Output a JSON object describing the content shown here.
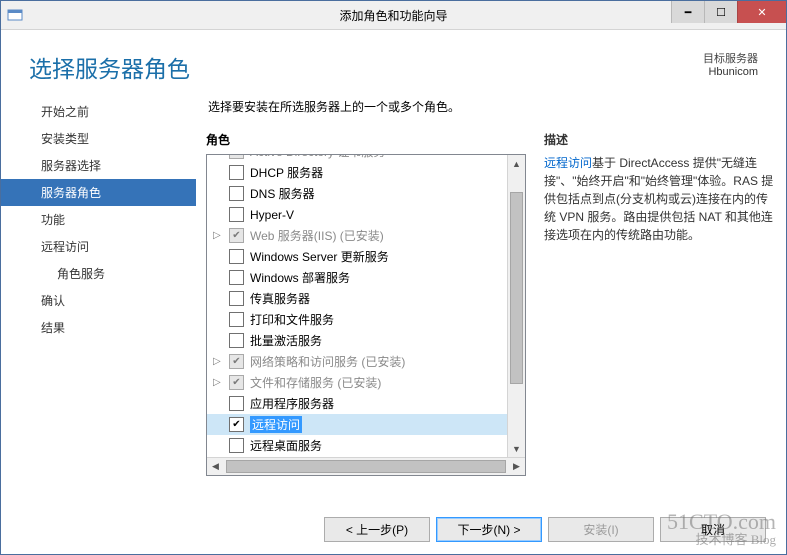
{
  "window": {
    "title": "添加角色和功能向导"
  },
  "header": {
    "page_title": "选择服务器角色",
    "target_label": "目标服务器",
    "target_value": "Hbunicom"
  },
  "nav": {
    "items": [
      {
        "label": "开始之前",
        "selected": false,
        "sub": false
      },
      {
        "label": "安装类型",
        "selected": false,
        "sub": false
      },
      {
        "label": "服务器选择",
        "selected": false,
        "sub": false
      },
      {
        "label": "服务器角色",
        "selected": true,
        "sub": false
      },
      {
        "label": "功能",
        "selected": false,
        "sub": false
      },
      {
        "label": "远程访问",
        "selected": false,
        "sub": false
      },
      {
        "label": "角色服务",
        "selected": false,
        "sub": true
      },
      {
        "label": "确认",
        "selected": false,
        "sub": false
      },
      {
        "label": "结果",
        "selected": false,
        "sub": false
      }
    ]
  },
  "content": {
    "instruction": "选择要安装在所选服务器上的一个或多个角色。",
    "roles_heading": "角色",
    "desc_heading": "描述",
    "desc_link": "远程访问",
    "desc_text": "基于 DirectAccess 提供\"无缝连接\"、\"始终开启\"和\"始终管理\"体验。RAS 提供包括点到点(分支机构或云)连接在内的传统 VPN 服务。路由提供包括 NAT 和其他连接选项在内的传统路由功能。",
    "roles": [
      {
        "label": "Active Directory 证书服务",
        "checked": false,
        "disabled": true,
        "expander": "",
        "selected": false,
        "cut": true
      },
      {
        "label": "DHCP 服务器",
        "checked": false,
        "disabled": false,
        "expander": "",
        "selected": false
      },
      {
        "label": "DNS 服务器",
        "checked": false,
        "disabled": false,
        "expander": "",
        "selected": false
      },
      {
        "label": "Hyper-V",
        "checked": false,
        "disabled": false,
        "expander": "",
        "selected": false
      },
      {
        "label": "Web 服务器(IIS) (已安装)",
        "checked": true,
        "disabled": true,
        "expander": "▷",
        "selected": false
      },
      {
        "label": "Windows Server 更新服务",
        "checked": false,
        "disabled": false,
        "expander": "",
        "selected": false
      },
      {
        "label": "Windows 部署服务",
        "checked": false,
        "disabled": false,
        "expander": "",
        "selected": false
      },
      {
        "label": "传真服务器",
        "checked": false,
        "disabled": false,
        "expander": "",
        "selected": false
      },
      {
        "label": "打印和文件服务",
        "checked": false,
        "disabled": false,
        "expander": "",
        "selected": false
      },
      {
        "label": "批量激活服务",
        "checked": false,
        "disabled": false,
        "expander": "",
        "selected": false
      },
      {
        "label": "网络策略和访问服务 (已安装)",
        "checked": true,
        "disabled": true,
        "expander": "▷",
        "selected": false
      },
      {
        "label": "文件和存储服务 (已安装)",
        "checked": true,
        "disabled": true,
        "expander": "▷",
        "selected": false
      },
      {
        "label": "应用程序服务器",
        "checked": false,
        "disabled": false,
        "expander": "",
        "selected": false
      },
      {
        "label": "远程访问",
        "checked": true,
        "disabled": false,
        "expander": "",
        "selected": true
      },
      {
        "label": "远程桌面服务",
        "checked": false,
        "disabled": false,
        "expander": "",
        "selected": false
      }
    ]
  },
  "footer": {
    "prev": "< 上一步(P)",
    "next": "下一步(N) >",
    "install": "安装(I)",
    "cancel": "取消"
  },
  "watermark": {
    "line1": "51CTO.com",
    "line2": "技术博客 Blog"
  }
}
